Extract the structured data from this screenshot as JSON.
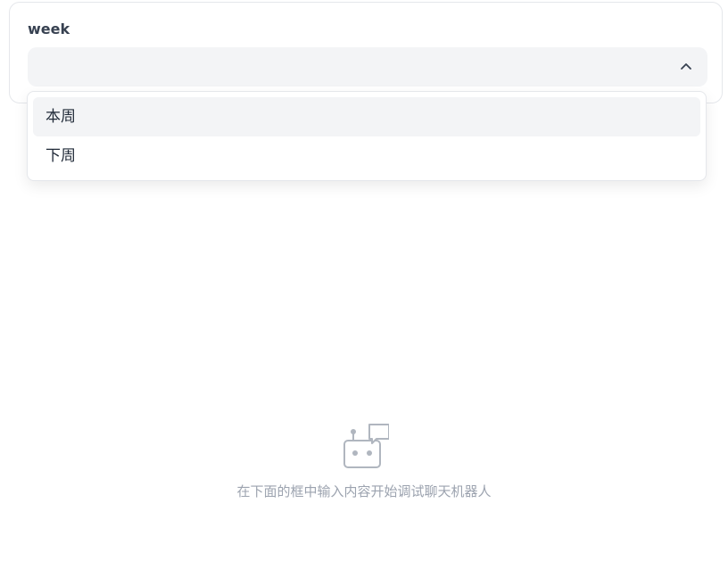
{
  "form": {
    "label": "week",
    "select": {
      "value": "",
      "options": [
        "本周",
        "下周"
      ],
      "highlighted_index": 0,
      "expanded": true
    }
  },
  "icons": {
    "chevron": "chevron-up-icon",
    "empty": "chatbot-icon"
  },
  "empty_state": {
    "text": "在下面的框中输入内容开始调试聊天机器人"
  },
  "colors": {
    "select_bg": "#f3f4f6",
    "muted_text": "#9ca3af",
    "label_text": "#374151"
  }
}
